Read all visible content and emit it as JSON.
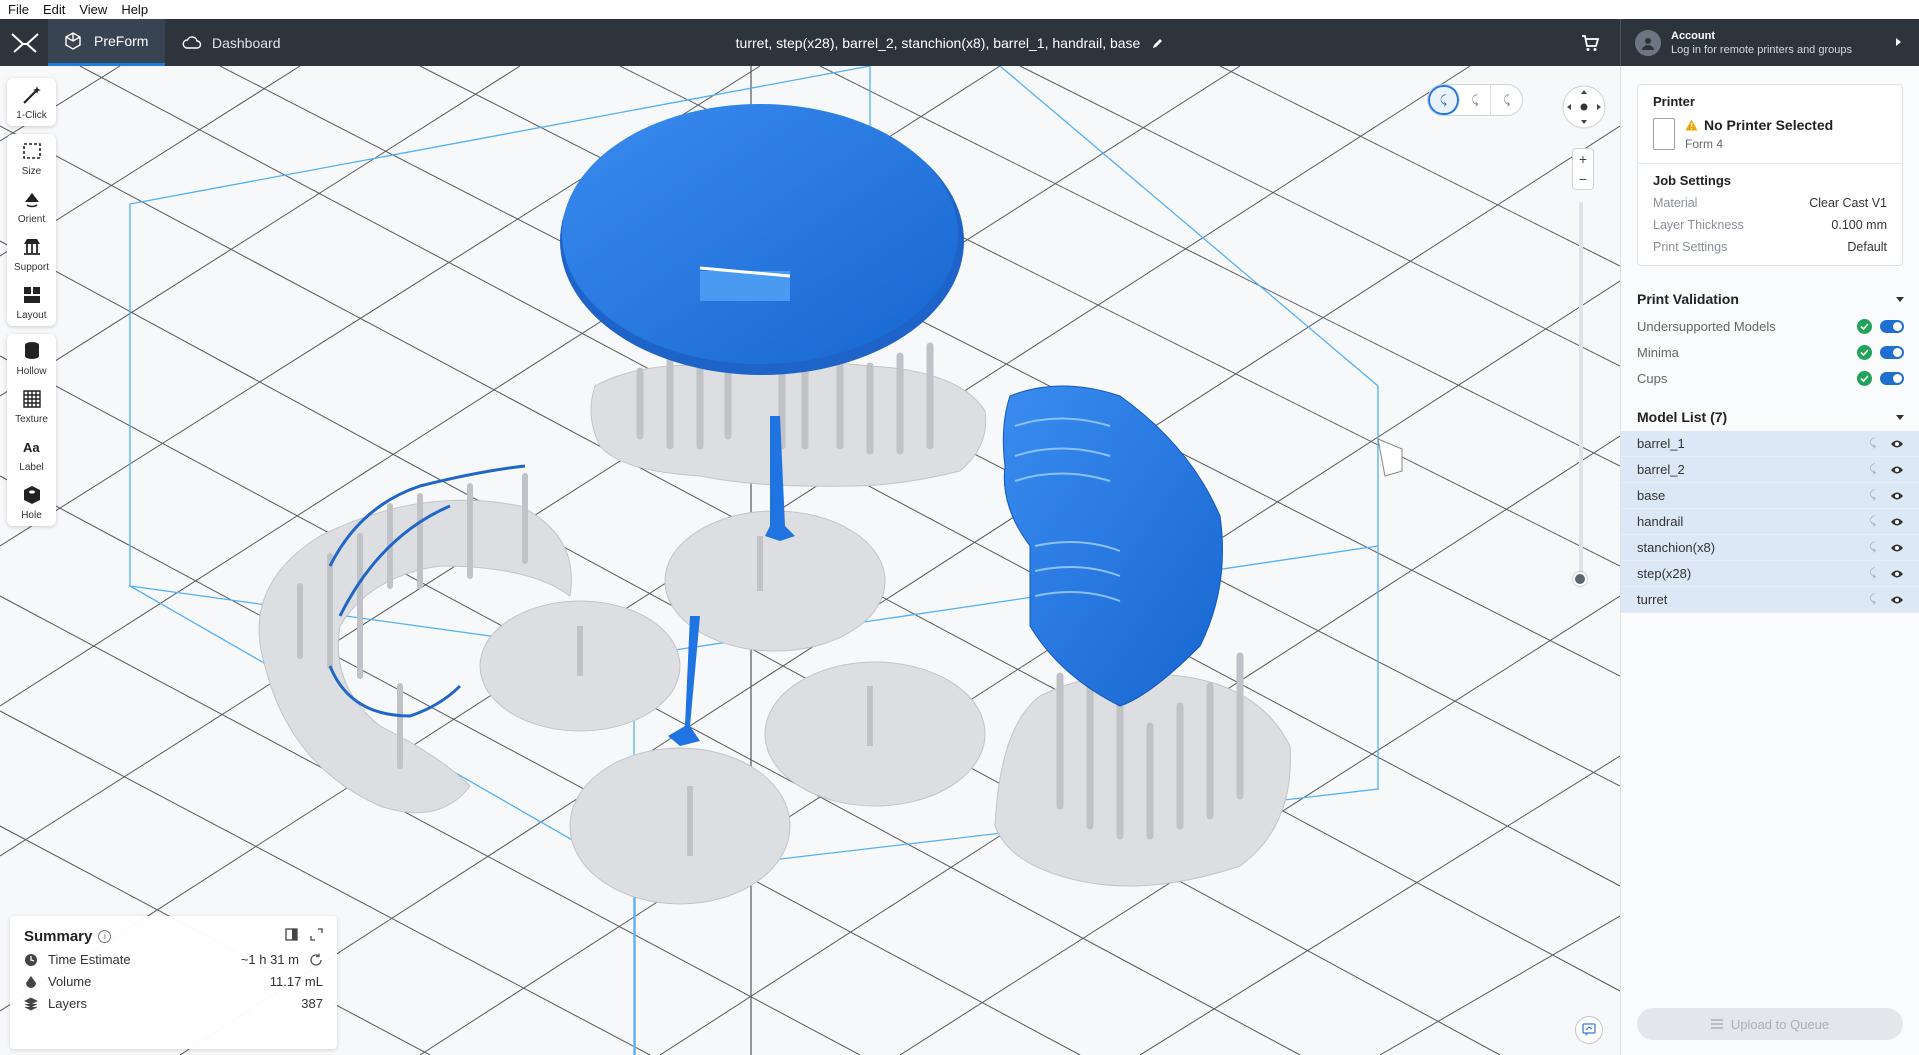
{
  "menu": [
    "File",
    "Edit",
    "View",
    "Help"
  ],
  "header": {
    "tab_preform": "PreForm",
    "tab_dashboard": "Dashboard",
    "job_title": "turret, step(x28), barrel_2, stanchion(x8), barrel_1, handrail, base",
    "account_title": "Account",
    "account_subtitle": "Log in for remote printers and groups"
  },
  "tools": [
    {
      "label": "1-Click",
      "icon": "magic-wand-icon"
    },
    {
      "label": "Size",
      "icon": "size-icon"
    },
    {
      "label": "Orient",
      "icon": "orient-icon"
    },
    {
      "label": "Support",
      "icon": "support-icon"
    },
    {
      "label": "Layout",
      "icon": "layout-icon"
    },
    {
      "label": "Hollow",
      "icon": "hollow-icon"
    },
    {
      "label": "Texture",
      "icon": "texture-icon"
    },
    {
      "label": "Label",
      "icon": "label-icon"
    },
    {
      "label": "Hole",
      "icon": "hole-icon"
    }
  ],
  "summary": {
    "title": "Summary",
    "rows": [
      {
        "label": "Time Estimate",
        "value": "~1 h 31 m"
      },
      {
        "label": "Volume",
        "value": "11.17 mL"
      },
      {
        "label": "Layers",
        "value": "387"
      }
    ]
  },
  "printer": {
    "section": "Printer",
    "name": "No Printer Selected",
    "model": "Form 4"
  },
  "job_settings": {
    "title": "Job Settings",
    "rows": [
      {
        "key": "Material",
        "value": "Clear Cast V1"
      },
      {
        "key": "Layer Thickness",
        "value": "0.100 mm"
      },
      {
        "key": "Print Settings",
        "value": "Default"
      }
    ]
  },
  "validation": {
    "title": "Print Validation",
    "rows": [
      "Undersupported Models",
      "Minima",
      "Cups"
    ]
  },
  "model_list": {
    "title": "Model List (7)",
    "items": [
      "barrel_1",
      "barrel_2",
      "base",
      "handrail",
      "stanchion(x8)",
      "step(x28)",
      "turret"
    ]
  },
  "upload_label": "Upload to Queue",
  "colors": {
    "header_bg": "#2e343c",
    "accent": "#1f7ae0",
    "model_blue": "#1f7ae6",
    "support_gray": "#d9dbde",
    "selected_row": "#dde8f7"
  }
}
